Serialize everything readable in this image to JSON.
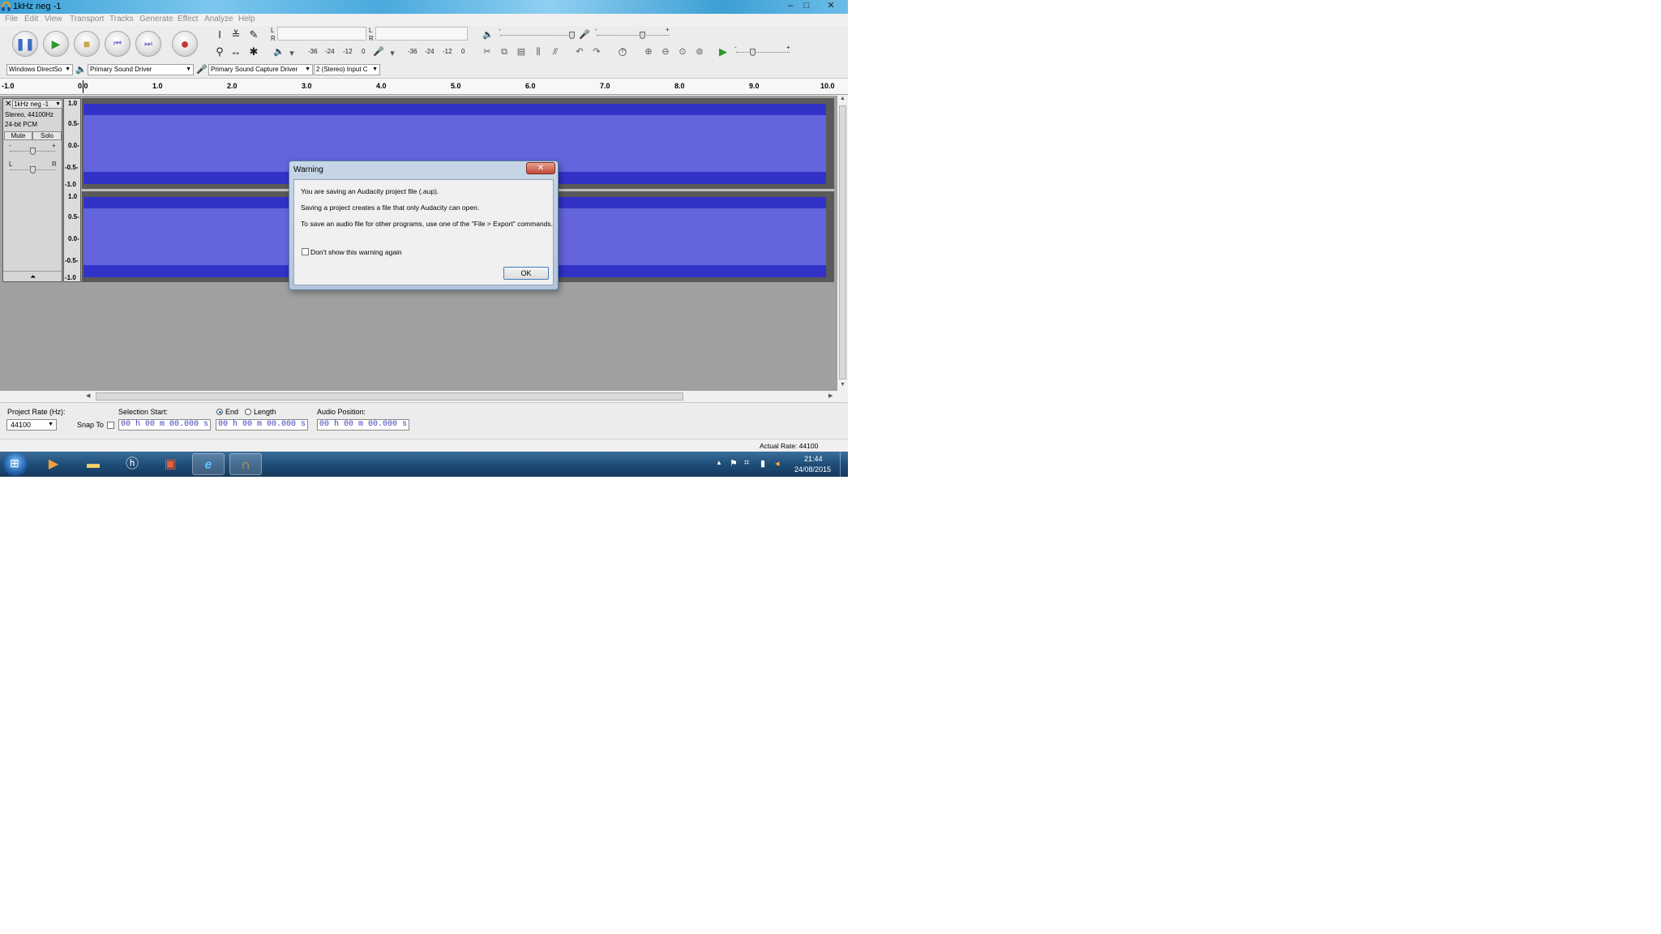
{
  "window": {
    "title": "1kHz neg -1",
    "minimize": "–",
    "maximize": "□",
    "close": "✕"
  },
  "menu": {
    "items": [
      "File",
      "Edit",
      "View",
      "Transport",
      "Tracks",
      "Generate",
      "Effect",
      "Analyze",
      "Help"
    ]
  },
  "meters": {
    "playback": {
      "left_label": "L",
      "right_label": "R",
      "ticks": [
        "-36",
        "-24",
        "-12",
        "0"
      ]
    },
    "record": {
      "left_label": "L",
      "right_label": "R",
      "ticks": [
        "-36",
        "-24",
        "-12",
        "0"
      ]
    },
    "output_volume": {
      "minus": "-",
      "plus": "+"
    },
    "input_volume": {
      "minus": "-",
      "plus": "+"
    },
    "play_speed": {
      "minus": "-",
      "plus": "+"
    }
  },
  "device_toolbar": {
    "host": "Windows DirectSo",
    "output_device": "Primary Sound Driver",
    "input_device": "Primary Sound Capture Driver",
    "channels": "2 (Stereo) Input C"
  },
  "ruler": {
    "ticks": [
      "-1.0",
      "0.0",
      "1.0",
      "2.0",
      "3.0",
      "4.0",
      "5.0",
      "6.0",
      "7.0",
      "8.0",
      "9.0",
      "10.0"
    ]
  },
  "track": {
    "name": "1kHz neg -1",
    "info_rate": "Stereo, 44100Hz",
    "info_format": "24-bit PCM",
    "mute": "Mute",
    "solo": "Solo",
    "gain_minus": "-",
    "gain_plus": "+",
    "pan_left": "L",
    "pan_right": "R",
    "scale": [
      "1.0",
      "0.5-",
      "0.0-",
      "-0.5-",
      "-1.0"
    ],
    "wave_color": "#3232c8",
    "wave_rms_color": "#6464dc"
  },
  "selection_bar": {
    "project_rate_label": "Project Rate (Hz):",
    "project_rate_value": "44100",
    "snap_to_label": "Snap To",
    "selection_start_label": "Selection Start:",
    "end_label": "End",
    "length_label": "Length",
    "audio_position_label": "Audio Position:",
    "selection_start_value": "00 h 00 m 00.000 s",
    "end_value": "00 h 00 m 00.000 s",
    "audio_position_value": "00 h 00 m 00.000 s"
  },
  "status_bar": {
    "actual_rate": "Actual Rate: 44100"
  },
  "dialog": {
    "title": "Warning",
    "close": "✕",
    "line1": "You are saving an Audacity project file (.aup).",
    "line2": "Saving a project creates a file that only Audacity can open.",
    "line3": "To save an audio file for other programs, use one of the \"File > Export\" commands.",
    "checkbox_label": "Don't show this warning again",
    "ok": "OK"
  },
  "taskbar": {
    "time": "21:44",
    "date": "24/08/2015"
  }
}
